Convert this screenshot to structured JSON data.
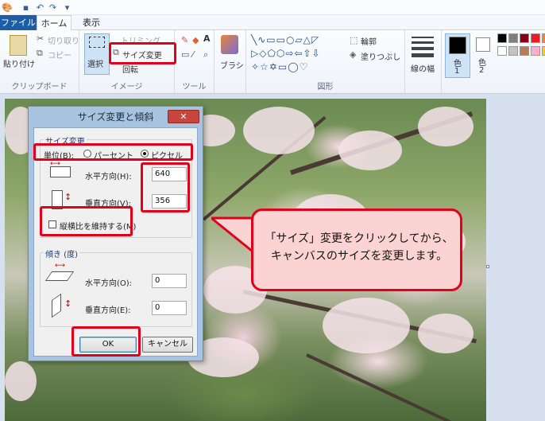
{
  "ribbon_tabs": {
    "file": "ファイル",
    "home": "ホーム",
    "view": "表示"
  },
  "clipboard": {
    "paste": "貼り付け",
    "cut": "切り取り",
    "copy": "コピー",
    "label": "クリップボード"
  },
  "image": {
    "select": "選択",
    "resize": "サイズ変更",
    "crop": "トリミング",
    "rotate": "回転",
    "label": "イメージ"
  },
  "tools": {
    "label": "ツール",
    "text_icon": "A"
  },
  "brush": {
    "label": "ブラシ"
  },
  "shapes": {
    "outline": "輪郭",
    "fill": "塗りつぶし",
    "label": "図形"
  },
  "line_width": {
    "label": "線の幅"
  },
  "color1": {
    "label": "色",
    "num": "1"
  },
  "color2": {
    "label": "色",
    "num": "2"
  },
  "palette": [
    "#000000",
    "#7f7f7f",
    "#880015",
    "#ed1c24",
    "#ff7f27",
    "#ffffff",
    "#c3c3c3",
    "#b97a57",
    "#ffaec9",
    "#ffc90e"
  ],
  "dialog": {
    "title": "サイズ変更と傾斜",
    "resize_section": "サイズ変更",
    "unit_label": "単位(B):",
    "unit_percent": "パーセント",
    "unit_pixel": "ピクセル",
    "unit_selected": "pixel",
    "horizontal_label": "水平方向(H):",
    "horizontal_value": "640",
    "vertical_label": "垂直方向(V):",
    "vertical_value": "356",
    "aspect_label": "縦横比を維持する(M)",
    "aspect_checked": false,
    "skew_section": "傾き (度)",
    "skew_h_label": "水平方向(O):",
    "skew_h_value": "0",
    "skew_v_label": "垂直方向(E):",
    "skew_v_value": "0",
    "ok": "OK",
    "cancel": "キャンセル"
  },
  "callout": {
    "line1": "「サイズ」変更をクリックしてから、",
    "line2": "キャンバスのサイズを変更します。"
  },
  "accent": "#e3001b",
  "tab_file_color": "#1b5ea8"
}
